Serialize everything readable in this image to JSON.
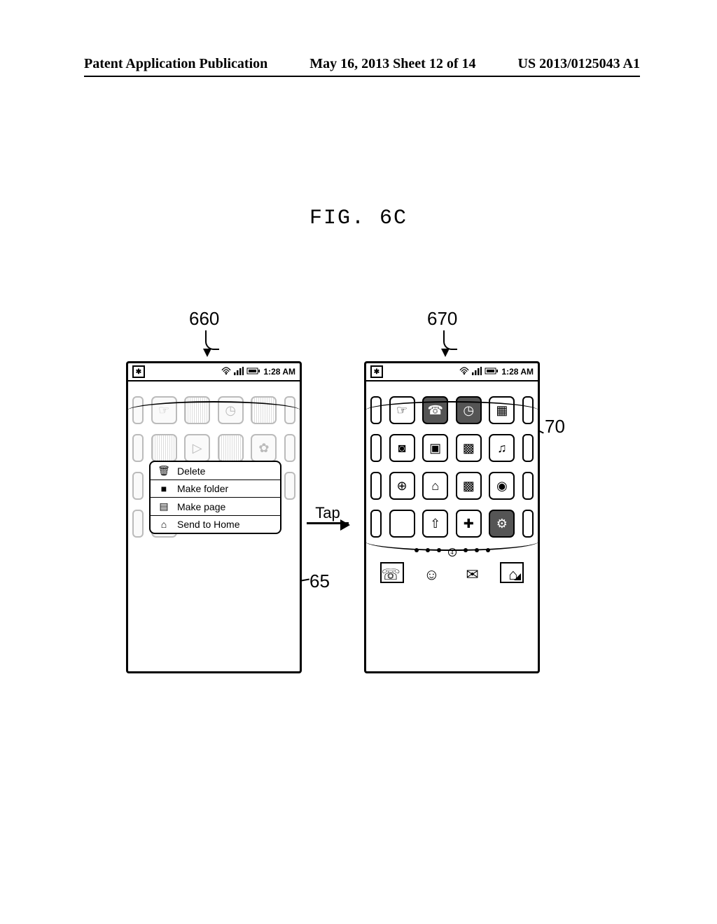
{
  "header": {
    "left": "Patent Application Publication",
    "center": "May 16, 2013  Sheet 12 of 14",
    "right": "US 2013/0125043 A1"
  },
  "figure_title": "FIG. 6C",
  "callouts": {
    "left_phone": "660",
    "right_phone": "670",
    "folder_ref": "70",
    "menu_ref": "65"
  },
  "interaction_label": "Tap",
  "status": {
    "time": "1:28 AM"
  },
  "context_menu": {
    "items": [
      {
        "icon": "trash-icon",
        "label": "Delete"
      },
      {
        "icon": "folder-icon",
        "label": "Make folder"
      },
      {
        "icon": "page-icon",
        "label": "Make page"
      },
      {
        "icon": "home-icon",
        "label": "Send to Home"
      }
    ]
  },
  "pager_current": "4"
}
